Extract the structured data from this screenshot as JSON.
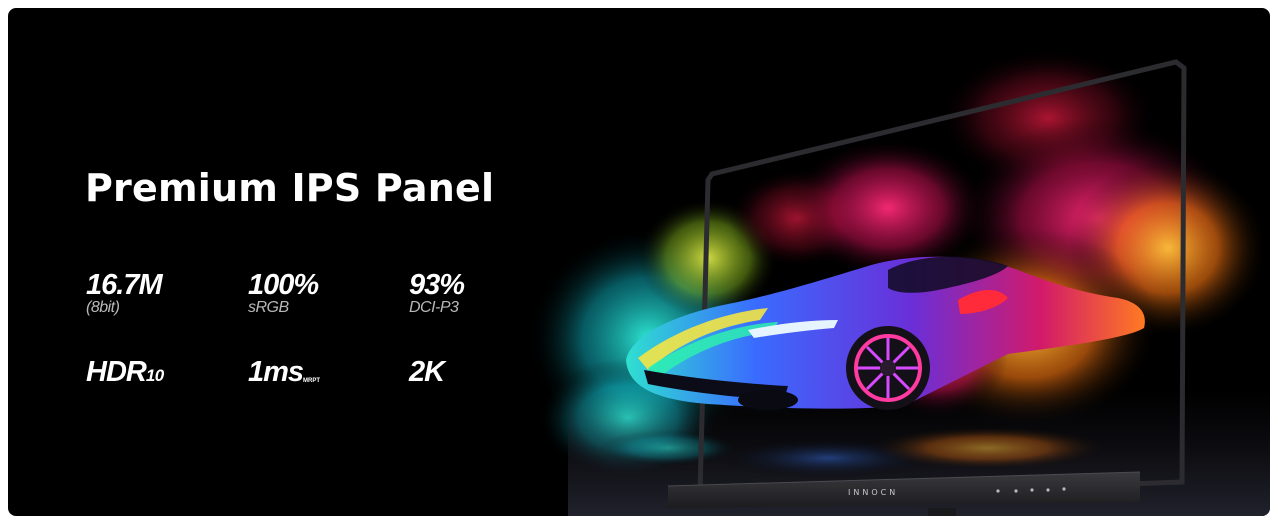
{
  "headline": "Premium IPS Panel",
  "specs": [
    {
      "value": "16.7M",
      "sub": "(8bit)"
    },
    {
      "value": "100%",
      "sub": "sRGB"
    },
    {
      "value": "93%",
      "sub": "DCI-P3"
    },
    {
      "value": "HDR",
      "value_small": "10"
    },
    {
      "value": "1ms",
      "value_tiny": "MRPT"
    },
    {
      "value": "2K"
    }
  ],
  "brand_logo": "INNOCN",
  "colors": {
    "background": "#000000",
    "text": "#ffffff",
    "subtext": "#b9b9b9",
    "smoke_teal": "#16d8c8",
    "smoke_magenta": "#e0187a",
    "smoke_orange": "#ff8a1c",
    "car_purple": "#5a2fd0"
  }
}
